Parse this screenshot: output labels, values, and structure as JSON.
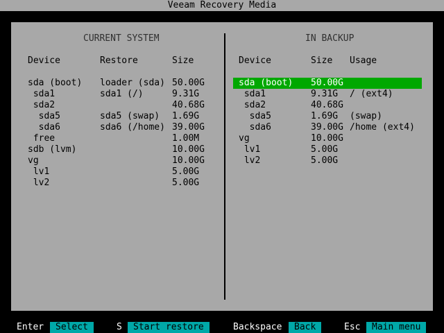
{
  "window": {
    "title": "Veeam Recovery Media"
  },
  "current_system": {
    "title": "CURRENT SYSTEM",
    "headers": {
      "device": "Device",
      "restore": "Restore",
      "size": "Size"
    },
    "rows": [
      {
        "device": "sda (boot)",
        "restore": "loader (sda)",
        "size": "50.00G"
      },
      {
        "device": " sda1",
        "restore": "sda1 (/)",
        "size": "9.31G"
      },
      {
        "device": " sda2",
        "restore": "",
        "size": "40.68G"
      },
      {
        "device": "  sda5",
        "restore": "sda5 (swap)",
        "size": "1.69G"
      },
      {
        "device": "  sda6",
        "restore": "sda6 (/home)",
        "size": "39.00G"
      },
      {
        "device": " free",
        "restore": "",
        "size": "1.00M"
      },
      {
        "device": "sdb (lvm)",
        "restore": "",
        "size": "10.00G"
      },
      {
        "device": "vg",
        "restore": "",
        "size": "10.00G"
      },
      {
        "device": " lv1",
        "restore": "",
        "size": "5.00G"
      },
      {
        "device": " lv2",
        "restore": "",
        "size": "5.00G"
      }
    ]
  },
  "in_backup": {
    "title": "IN BACKUP",
    "headers": {
      "device": "Device",
      "size": "Size",
      "usage": "Usage"
    },
    "selected_row": 0,
    "rows": [
      {
        "device": "sda (boot)",
        "size": "50.00G",
        "usage": ""
      },
      {
        "device": " sda1",
        "size": "9.31G",
        "usage": "/ (ext4)"
      },
      {
        "device": " sda2",
        "size": "40.68G",
        "usage": ""
      },
      {
        "device": "  sda5",
        "size": "1.69G",
        "usage": "(swap)"
      },
      {
        "device": "  sda6",
        "size": "39.00G",
        "usage": "/home (ext4)"
      },
      {
        "device": "vg",
        "size": "10.00G",
        "usage": ""
      },
      {
        "device": " lv1",
        "size": "5.00G",
        "usage": ""
      },
      {
        "device": " lv2",
        "size": "5.00G",
        "usage": ""
      }
    ]
  },
  "footer": {
    "enter_key": "Enter",
    "enter_action": "Select",
    "s_key": "S",
    "s_action": "Start restore",
    "backspace_key": "Backspace",
    "backspace_action": "Back",
    "esc_key": "Esc",
    "esc_action": "Main menu"
  },
  "colors": {
    "panel_bg": "#a8a8a8",
    "screen_bg": "#000000",
    "highlight": "#00a800",
    "action_bg": "#00a8a8"
  }
}
